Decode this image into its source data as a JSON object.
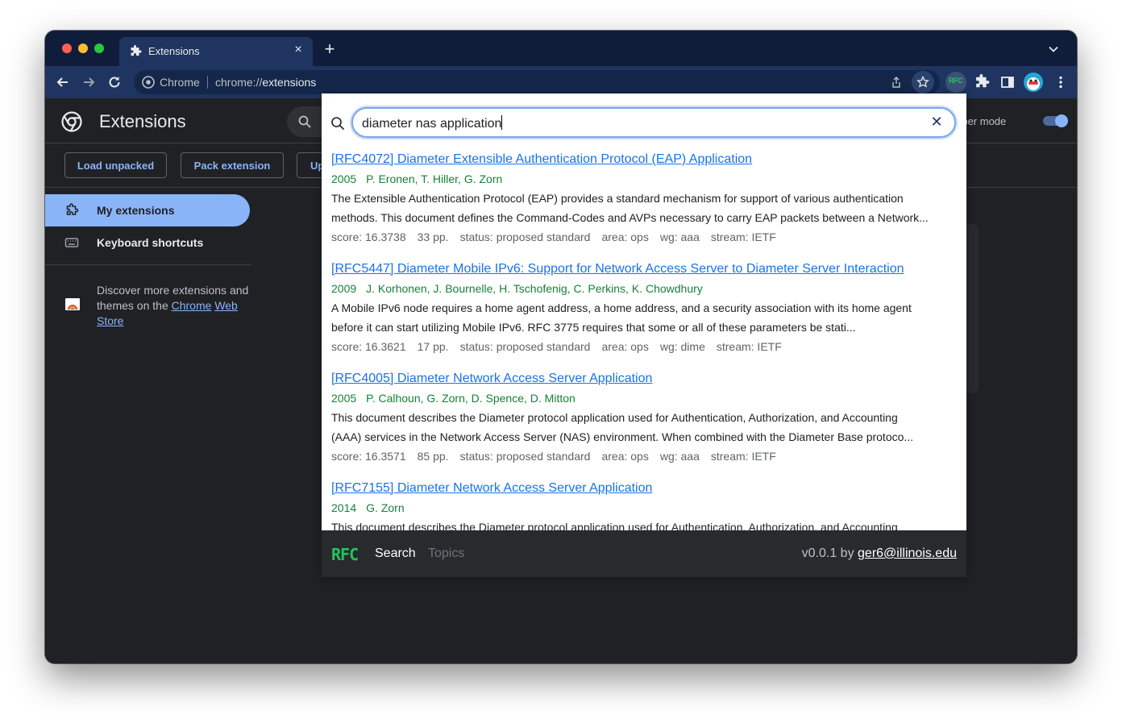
{
  "browser": {
    "tab": {
      "title": "Extensions",
      "close": "×"
    },
    "new_tab": "+",
    "omnibox": {
      "site_label": "Chrome",
      "url_prefix": "chrome://",
      "url_path": "extensions"
    },
    "extension_badge": "RFC"
  },
  "page": {
    "title": "Extensions",
    "developer_mode_label": "eloper mode",
    "developer_mode_on": true,
    "actions": [
      "Load unpacked",
      "Pack extension",
      "Up"
    ],
    "sidebar": [
      {
        "label": "My extensions",
        "active": true,
        "icon": "extension-icon"
      },
      {
        "label": "Keyboard shortcuts",
        "active": false,
        "icon": "keyboard-icon"
      }
    ],
    "discover": {
      "text": "Discover more extensions and themes on the ",
      "link1": "Chrome",
      "link2": "Web Store"
    }
  },
  "popup": {
    "query": "diameter nas application",
    "results": [
      {
        "title": "[RFC4072] Diameter Extensible Authentication Protocol (EAP) Application",
        "year": "2005",
        "authors": "P. Eronen, T. Hiller, G. Zorn",
        "desc1": "The Extensible Authentication Protocol (EAP) provides a standard mechanism for support of various authentication",
        "desc2": "methods. This document defines the Command-Codes and AVPs necessary to carry EAP packets between a Network...",
        "score": "score: 16.3738",
        "pages": "33 pp.",
        "status": "status: proposed standard",
        "area": "area: ops",
        "wg": "wg: aaa",
        "stream": "stream: IETF"
      },
      {
        "title": "[RFC5447] Diameter Mobile IPv6: Support for Network Access Server to Diameter Server Interaction",
        "year": "2009",
        "authors": "J. Korhonen, J. Bournelle, H. Tschofenig, C. Perkins, K. Chowdhury",
        "desc1": "A Mobile IPv6 node requires a home agent address, a home address, and a security association with its home agent",
        "desc2": "before it can start utilizing Mobile IPv6. RFC 3775 requires that some or all of these parameters be stati...",
        "score": "score: 16.3621",
        "pages": "17 pp.",
        "status": "status: proposed standard",
        "area": "area: ops",
        "wg": "wg: dime",
        "stream": "stream: IETF"
      },
      {
        "title": "[RFC4005] Diameter Network Access Server Application",
        "year": "2005",
        "authors": "P. Calhoun, G. Zorn, D. Spence, D. Mitton",
        "desc1": "This document describes the Diameter protocol application used for Authentication, Authorization, and Accounting",
        "desc2": "(AAA) services in the Network Access Server (NAS) environment. When combined with the Diameter Base protoco...",
        "score": "score: 16.3571",
        "pages": "85 pp.",
        "status": "status: proposed standard",
        "area": "area: ops",
        "wg": "wg: aaa",
        "stream": "stream: IETF"
      },
      {
        "title": "[RFC7155] Diameter Network Access Server Application",
        "year": "2014",
        "authors": "G. Zorn",
        "desc1": "This document describes the Diameter protocol application used for Authentication, Authorization, and Accounting",
        "desc2": "",
        "score": "",
        "pages": "",
        "status": "",
        "area": "",
        "wg": "",
        "stream": ""
      }
    ],
    "footer": {
      "logo": "RFC",
      "tabs": [
        "Search",
        "Topics"
      ],
      "version_prefix": "v0.0.1 by ",
      "author": "ger6@illinois.edu"
    }
  },
  "colors": {
    "accent": "#8ab4f8",
    "link": "#1a73e8",
    "meta_green": "#188038",
    "rfc_green": "#22c55e",
    "toolbar": "#1f3460"
  }
}
